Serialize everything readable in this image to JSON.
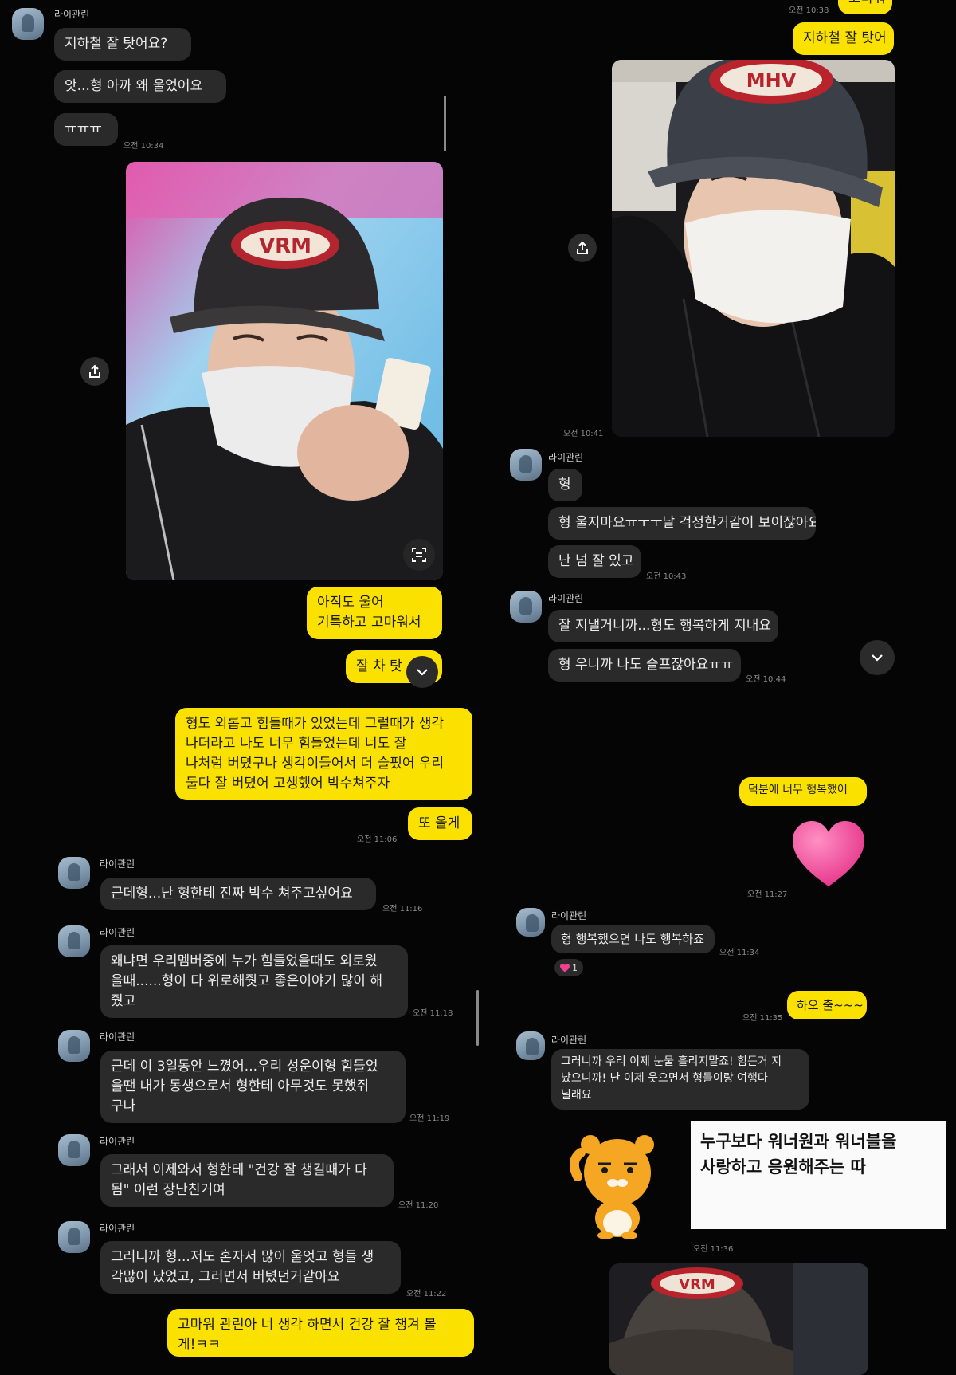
{
  "sender_name": "라이관린",
  "left": {
    "msg1": "지하철 잘 탓어요?",
    "msg2": "앗...형 아까 왜 울었어요",
    "msg3": "ㅠㅠㅠ",
    "time1": "오전 10:34",
    "photo_cap_text": "VRM",
    "reply1": "아직도 울어\n기특하고 고마워서",
    "reply2": "잘 차 탓",
    "reply3": "형도 외롭고 힘들때가 있었는데 그럴때가 생각\n나더라고 나도 너무 힘들었는데 너도 잘\n나처럼 버텼구나 생각이들어서 더 슬펐어 우리\n둘다 잘 버텼어 고생했어 박수쳐주자",
    "reply4": "또 올게",
    "time2": "오전 11:06",
    "msg4": "근데형...난 형한테 진짜 박수 쳐주고싶어요",
    "time3": "오전 11:16",
    "msg5": "왜냐면 우리멤버중에 누가 힘들었을때도 외로웠\n을때......형이 다 위로해줫고 좋은이야기 많이 해\n줬고",
    "time4": "오전 11:18",
    "msg6": "근데 이 3일동안 느꼈어...우리 성운이형 힘들었\n을땐 내가 동생으로서 형한테 아무것도 못했쥐\n구나",
    "time5": "오전 11:19",
    "msg7": "그래서 이제와서 형한테 \"건강 잘 챙길때가 다\n됨\" 이런 장난친거여",
    "time6": "오전 11:20",
    "msg8": "그러니까 형...저도 혼자서 많이 울엇고 형들 생\n각많이 났었고, 그러면서 버텼던거같아요",
    "time7": "오전 11:22",
    "reply5": "고마워 관린아 너 생각 하면서 건강 잘 챙겨 볼\n게!ㅋㅋ"
  },
  "right": {
    "top_fragment": "고마워",
    "top_time": "오전 10:38",
    "reply1": "지하철 잘 탓어",
    "photo_cap_text": "MHV",
    "photo_time": "오전 10:41",
    "msg1": "형",
    "msg2": "형 울지마요ㅠㅜㅜ날 걱정한거같이 보이잖아요",
    "msg3": "난 넘 잘 있고",
    "time1": "오전 10:43",
    "msg4": "잘 지낼거니까...형도 행복하게 지내요",
    "msg5": "형 우니까 나도 슬프잖아요ㅠㅠ",
    "time2": "오전 10:44",
    "reply2": "덕분에 너무 행복했어",
    "time3": "오전 11:27",
    "msg6": "형 행복했으면 나도 행복하죠",
    "time4": "오전 11:34",
    "reaction_count": "1",
    "reply3": "하오 출~~~",
    "time5": "오전 11:35",
    "msg7": "그러니까 우리 이제 눈물 흘리지말죠! 힘든거 지\n났으니까! 난 이제 웃으면서 형들이랑 여행다\n닐래요",
    "caption": "누구보다 워너원과 워너블을\n사랑하고 응원해주는 따",
    "time6": "오전 11:36",
    "photo2_cap_text": "VRM"
  },
  "colors": {
    "background": "#050505",
    "gray_bubble": "#2a2a2a",
    "yellow_bubble": "#fae100",
    "heart": "#f0408f",
    "ryan": "#f5a623"
  }
}
